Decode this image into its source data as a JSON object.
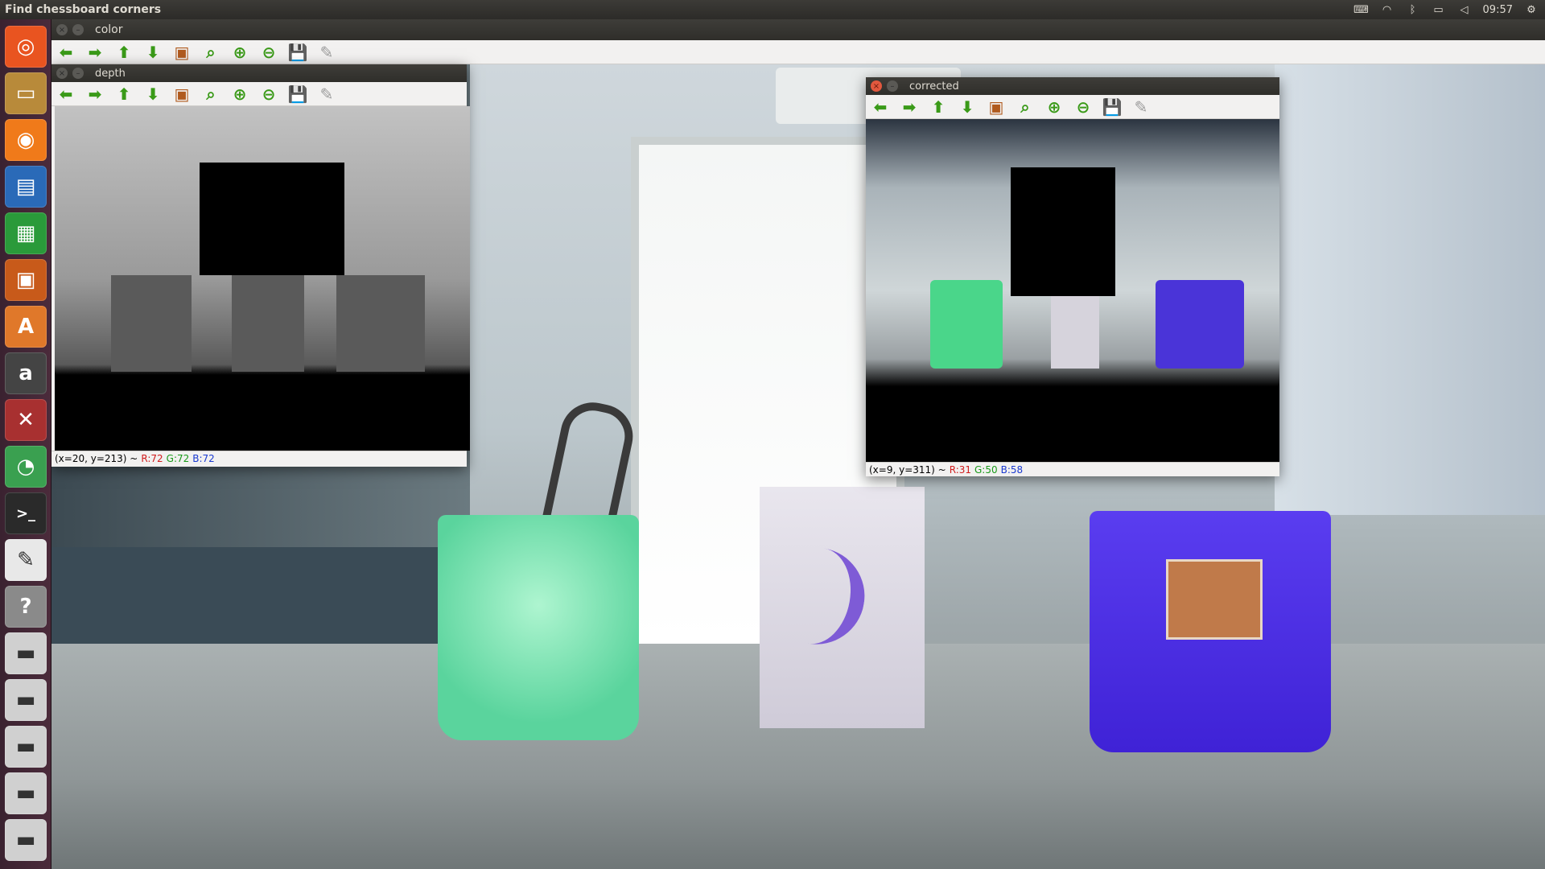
{
  "top_panel": {
    "app_title": "Find chessboard corners",
    "clock": "09:57",
    "icons": [
      "keyboard-icon",
      "wifi-icon",
      "bluetooth-icon",
      "battery-icon",
      "volume-icon",
      "gear-icon"
    ]
  },
  "launcher": {
    "items": [
      {
        "name": "ubuntu-dash",
        "glyph": "◎",
        "color": "#e95420"
      },
      {
        "name": "files",
        "glyph": "▭",
        "color": "#b88a3a"
      },
      {
        "name": "firefox",
        "glyph": "◉",
        "color": "#f07a1a"
      },
      {
        "name": "writer",
        "glyph": "▤",
        "color": "#2a6ab8"
      },
      {
        "name": "calc",
        "glyph": "▦",
        "color": "#2a9a3a"
      },
      {
        "name": "impress",
        "glyph": "▣",
        "color": "#c85a1a"
      },
      {
        "name": "software-center",
        "glyph": "A",
        "color": "#e0782a"
      },
      {
        "name": "amazon",
        "glyph": "a",
        "color": "#444444"
      },
      {
        "name": "system-settings",
        "glyph": "✕",
        "color": "#a83030"
      },
      {
        "name": "qt-app",
        "glyph": "◔",
        "color": "#3aa050"
      },
      {
        "name": "terminal",
        "glyph": ">_",
        "color": "#2a2a2a"
      },
      {
        "name": "text-editor",
        "glyph": "✎",
        "color": "#e8e8e8"
      },
      {
        "name": "help",
        "glyph": "?",
        "color": "#8a8a8a"
      },
      {
        "name": "drive-1",
        "glyph": "▬",
        "color": "#d0d0d0"
      },
      {
        "name": "drive-2",
        "glyph": "▬",
        "color": "#d0d0d0"
      },
      {
        "name": "drive-3",
        "glyph": "▬",
        "color": "#d0d0d0"
      },
      {
        "name": "drive-4",
        "glyph": "▬",
        "color": "#d0d0d0"
      },
      {
        "name": "drive-5",
        "glyph": "▬",
        "color": "#d0d0d0"
      }
    ]
  },
  "windows": {
    "color": {
      "title": "color"
    },
    "depth": {
      "title": "depth",
      "status": {
        "coords": "(x=20, y=213) ~",
        "r": "R:72",
        "g": "G:72",
        "b": "B:72"
      }
    },
    "corrected": {
      "title": "corrected",
      "status": {
        "coords": "(x=9, y=311) ~",
        "r": "R:31",
        "g": "G:50",
        "b": "B:58"
      }
    }
  },
  "toolbar": {
    "buttons": [
      {
        "name": "pan-left-button",
        "glyph": "⬅"
      },
      {
        "name": "pan-right-button",
        "glyph": "➡"
      },
      {
        "name": "pan-up-button",
        "glyph": "⬆"
      },
      {
        "name": "pan-down-button",
        "glyph": "⬇"
      },
      {
        "name": "zoom-fit-button",
        "glyph": "▣"
      },
      {
        "name": "zoom-original-button",
        "glyph": "⌕"
      },
      {
        "name": "zoom-in-button",
        "glyph": "⊕"
      },
      {
        "name": "zoom-out-button",
        "glyph": "⊖"
      },
      {
        "name": "save-button",
        "glyph": "💾"
      },
      {
        "name": "properties-button",
        "glyph": "✎"
      }
    ]
  },
  "colors": {
    "launcher_bg": "#4b2b3b",
    "panel_bg": "#3c3b37",
    "close_button": "#e2583e",
    "toolbar_green": "#3a9a18"
  }
}
